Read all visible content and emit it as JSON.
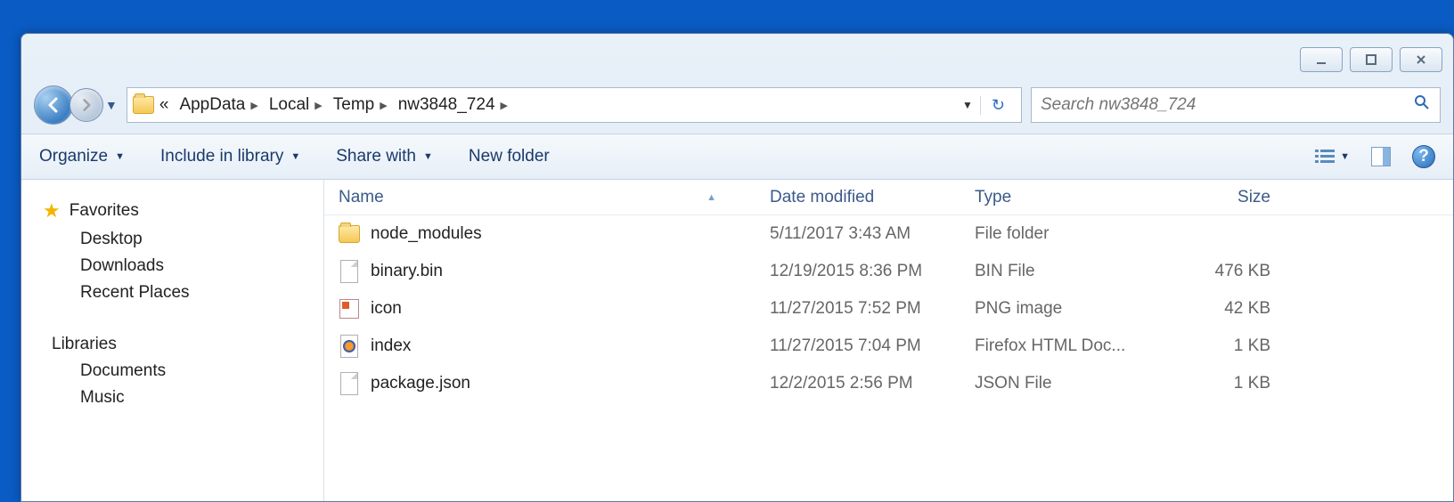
{
  "breadcrumb": {
    "prefix": "«",
    "items": [
      "AppData",
      "Local",
      "Temp",
      "nw3848_724"
    ]
  },
  "search": {
    "placeholder": "Search nw3848_724"
  },
  "toolbar": {
    "organize": "Organize",
    "include": "Include in library",
    "share": "Share with",
    "newfolder": "New folder"
  },
  "sidebar": {
    "favorites": "Favorites",
    "desktop": "Desktop",
    "downloads": "Downloads",
    "recent": "Recent Places",
    "libraries": "Libraries",
    "documents": "Documents",
    "music": "Music"
  },
  "columns": {
    "name": "Name",
    "date": "Date modified",
    "type": "Type",
    "size": "Size"
  },
  "files": [
    {
      "name": "node_modules",
      "date": "5/11/2017 3:43 AM",
      "type": "File folder",
      "size": "",
      "icon": "folder"
    },
    {
      "name": "binary.bin",
      "date": "12/19/2015 8:36 PM",
      "type": "BIN File",
      "size": "476 KB",
      "icon": "doc"
    },
    {
      "name": "icon",
      "date": "11/27/2015 7:52 PM",
      "type": "PNG image",
      "size": "42 KB",
      "icon": "png"
    },
    {
      "name": "index",
      "date": "11/27/2015 7:04 PM",
      "type": "Firefox HTML Doc...",
      "size": "1 KB",
      "icon": "firefox"
    },
    {
      "name": "package.json",
      "date": "12/2/2015 2:56 PM",
      "type": "JSON File",
      "size": "1 KB",
      "icon": "doc"
    }
  ]
}
